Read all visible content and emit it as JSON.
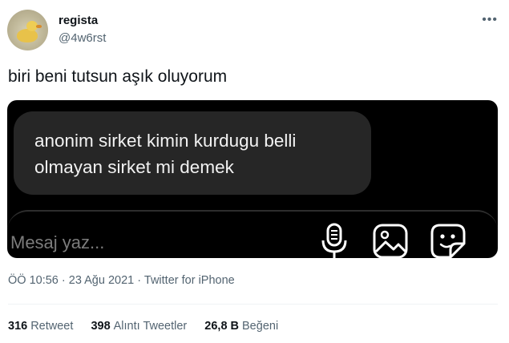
{
  "user": {
    "name": "regista",
    "handle": "@4w6rst"
  },
  "more_icon": "more-horizontal-icon",
  "tweet": {
    "text": "biri beni tutsun aşık oluyorum"
  },
  "media": {
    "bubble_lines": [
      "anonim sirket kimin kurdugu belli",
      "olmayan sirket mi demek"
    ],
    "compose_placeholder": "Mesaj yaz...",
    "icons": [
      "microphone-icon",
      "gallery-icon",
      "sticker-icon"
    ]
  },
  "meta": {
    "time": "ÖÖ 10:56",
    "separator1": "·",
    "date": "23 Ağu 2021",
    "separator2": "·",
    "source": "Twitter for iPhone"
  },
  "stats": {
    "retweets": {
      "count": "316",
      "label": "Retweet"
    },
    "quotes": {
      "count": "398",
      "label": "Alıntı Tweetler"
    },
    "likes": {
      "count": "26,8 B",
      "label": "Beğeni"
    }
  },
  "colors": {
    "media_bg": "#000000",
    "bubble_bg": "#262626",
    "secondary_text": "#536471"
  }
}
